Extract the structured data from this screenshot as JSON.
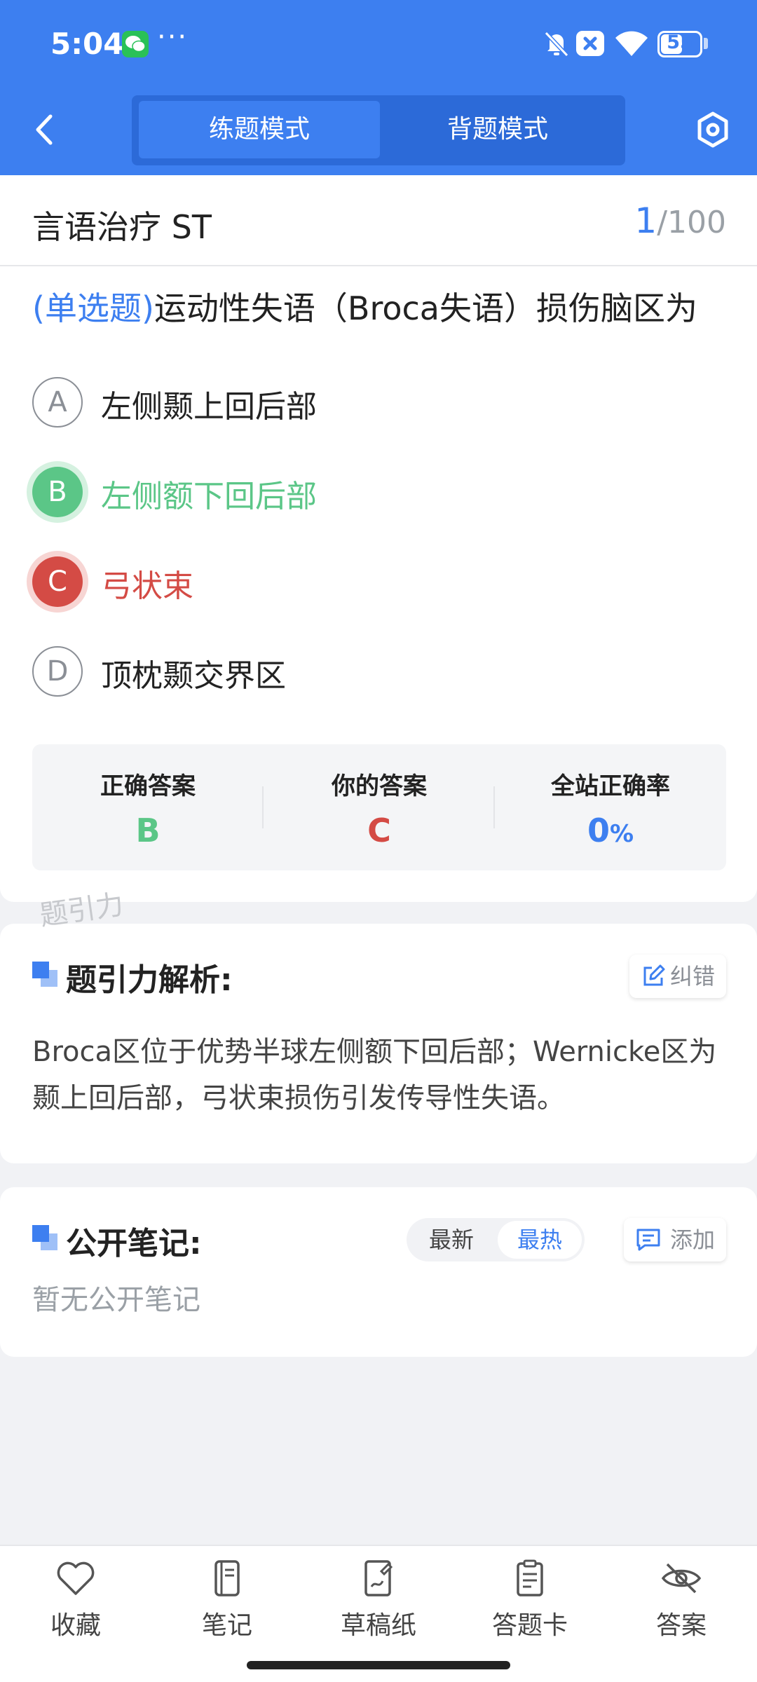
{
  "status_bar": {
    "time": "5:04",
    "dots": "···",
    "battery": "55",
    "icons": [
      "wechat-icon",
      "bell-off-icon",
      "close-box-icon",
      "wifi-icon",
      "battery-icon"
    ]
  },
  "header": {
    "mode_practice": "练题模式",
    "mode_recite": "背题模式",
    "icons": [
      "back-icon",
      "settings-icon"
    ]
  },
  "question": {
    "subject": "言语治疗 ST",
    "current": "1",
    "total": "/100",
    "type": "(单选题)",
    "text": "运动性失语（Broca失语）损伤脑区为",
    "options": [
      {
        "letter": "A",
        "text": "左侧颞上回后部",
        "state": "normal"
      },
      {
        "letter": "B",
        "text": "左侧额下回后部",
        "state": "correct"
      },
      {
        "letter": "C",
        "text": "弓状束",
        "state": "wrong"
      },
      {
        "letter": "D",
        "text": "顶枕颞交界区",
        "state": "normal"
      }
    ]
  },
  "answer_summary": {
    "correct_label": "正确答案",
    "correct_value": "B",
    "yours_label": "你的答案",
    "yours_value": "C",
    "rate_label": "全站正确率",
    "rate_value": "0",
    "rate_unit": "%"
  },
  "watermark": "题引力",
  "analysis": {
    "title": "题引力解析:",
    "report_label": "纠错",
    "text": "Broca区位于优势半球左侧额下回后部；Wernicke区为颞上回后部，弓状束损伤引发传导性失语。"
  },
  "notes": {
    "title": "公开笔记:",
    "sort_latest": "最新",
    "sort_hot": "最热",
    "add_label": "添加",
    "empty": "暂无公开笔记"
  },
  "bottom_tabs": [
    {
      "label": "收藏",
      "icon": "heart-icon"
    },
    {
      "label": "笔记",
      "icon": "notebook-icon"
    },
    {
      "label": "草稿纸",
      "icon": "draft-icon"
    },
    {
      "label": "答题卡",
      "icon": "answer-card-icon"
    },
    {
      "label": "答案",
      "icon": "eye-off-icon"
    }
  ],
  "colors": {
    "brand": "#3d7ff0",
    "correct": "#5bc687",
    "wrong": "#d44b45"
  }
}
